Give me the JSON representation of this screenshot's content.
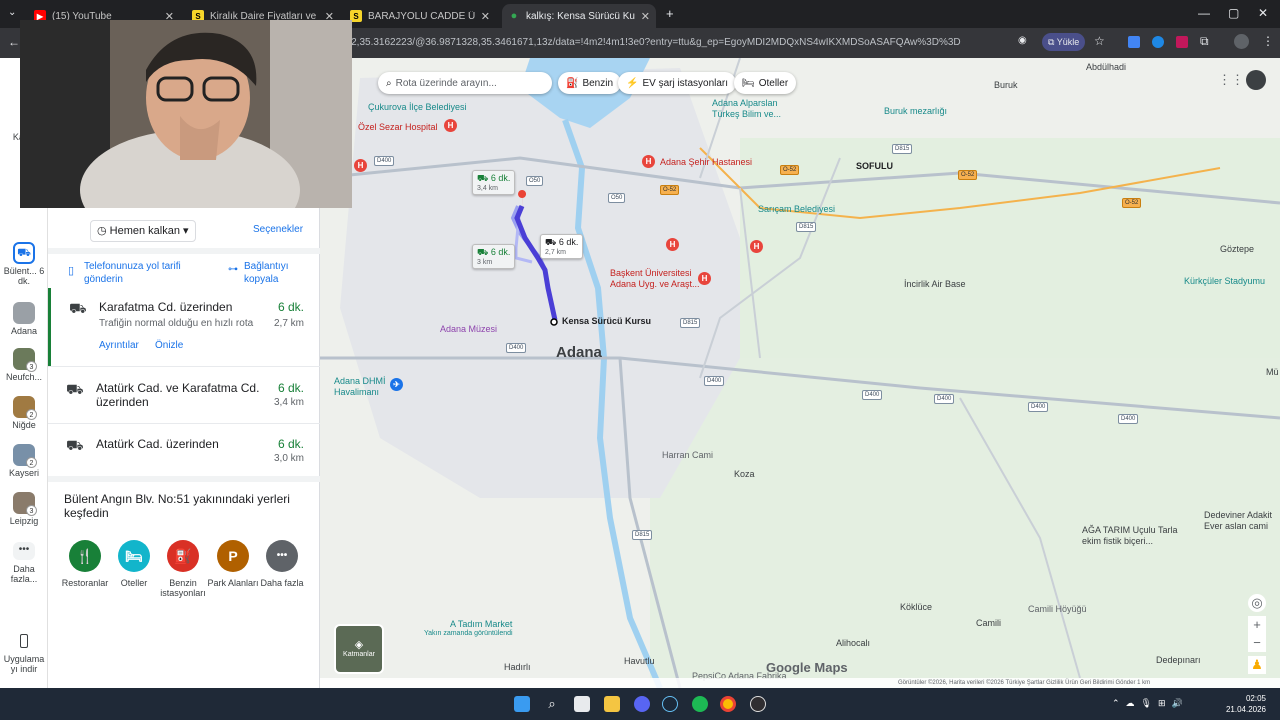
{
  "browser": {
    "tabs": [
      {
        "title": "(15) YouTube",
        "favicon_color": "#ff0000",
        "favicon_glyph": "▶"
      },
      {
        "title": "Kiralık Daire Fiyatları ve Kiralık",
        "favicon_color": "#f6d52a",
        "favicon_glyph": "S"
      },
      {
        "title": "BARAJYOLU CADDE ÜSTÜ BOŞ",
        "favicon_color": "#f6d52a",
        "favicon_glyph": "S"
      },
      {
        "title": "kalkış: Kensa Sürücü Kursu, Kur",
        "favicon_color": "#34a853",
        "favicon_glyph": "●",
        "active": true
      }
    ],
    "new_tab": "+",
    "window_controls": [
      "—",
      "▢",
      "✕"
    ],
    "url": "062,35.3162223/@36.9871328,35.3461671,13z/data=!4m2!4m1!3e0?entry=ttu&g_ep=EgoyMDI2MDQxNS4wIKXMDSoASAFQAw%3D%3D",
    "install_label": "Yükle"
  },
  "rail": {
    "items": [
      {
        "label": "Kay...",
        "badge": ""
      },
      {
        "label": "Bülent... 6 dk.",
        "badge": ""
      },
      {
        "label": "Adana",
        "badge": ""
      },
      {
        "label": "Neufch...",
        "badge": "3"
      },
      {
        "label": "Niğde",
        "badge": "2"
      },
      {
        "label": "Kayseri",
        "badge": "2"
      },
      {
        "label": "Leipzig",
        "badge": "3"
      },
      {
        "label": "Daha fazla...",
        "badge": ""
      },
      {
        "label": "Uygulama yı indir",
        "badge": ""
      }
    ]
  },
  "panel": {
    "depart_label": "Hemen kalkan",
    "options_label": "Seçenekler",
    "send_label": "Telefonunuza yol tarifi gönderin",
    "copy_label": "Bağlantıyı kopyala",
    "routes": [
      {
        "name": "Karafatma Cd. üzerinden",
        "time": "6 dk.",
        "dist": "2,7 km",
        "desc": "Trafiğin normal olduğu en hızlı rota",
        "details": "Ayrıntılar",
        "preview": "Önizle"
      },
      {
        "name": "Atatürk Cad. ve Karafatma Cd. üzerinden",
        "time": "6 dk.",
        "dist": "3,4 km"
      },
      {
        "name": "Atatürk Cad. üzerinden",
        "time": "6 dk.",
        "dist": "3,0 km"
      }
    ],
    "explore_title": "Bülent Angın Blv. No:51 yakınındaki yerleri keşfedin",
    "categories": [
      {
        "label": "Restoranlar",
        "color": "#188038",
        "glyph": "🍴"
      },
      {
        "label": "Oteller",
        "color": "#12b5cb",
        "glyph": "🛏"
      },
      {
        "label": "Benzin istasyonları",
        "color": "#d93025",
        "glyph": "⛽"
      },
      {
        "label": "Park Alanları",
        "color": "#b06000",
        "glyph": "P"
      },
      {
        "label": "Daha fazla",
        "color": "#5f6368",
        "glyph": "•••"
      }
    ]
  },
  "map": {
    "search_placeholder": "Rota üzerinde arayın...",
    "chips": [
      "Benzin",
      "EV şarj istasyonları",
      "Oteller"
    ],
    "labels": {
      "abdulhadi": "Abdülhadi",
      "cukurova": "Çukurova İlçe Belediyesi",
      "ozel_sezar": "Özel Sezar Hospital",
      "alparslan": "Adana Alparslan Türkeş Bilim ve...",
      "buruk_mezarligi": "Buruk mezarlığı",
      "buruk": "Buruk",
      "sehir_hastanesi": "Adana Şehir Hastanesi",
      "sofulu": "SOFULU",
      "saricam": "Sarıçam Belediyesi",
      "goztepe": "Göztepe",
      "baskent": "Başkent Üniversitesi Adana Uyg. ve Araşt...",
      "incirlik": "İncirlik Air Base",
      "kurkculer": "Kürkçüler Stadyumu",
      "destination": "Kensa Sürücü Kursu",
      "adana_muzesi": "Adana Müzesi",
      "adana": "Adana",
      "dhmi": "Adana DHMİ Havalimanı",
      "harran": "Harran Cami",
      "koza": "Koza",
      "agatarim": "AĞA TARIM Uçulu Tarla ekim fistik biçeri...",
      "devemir": "Dedeviner Adakit Ever aslan cami",
      "tadim": "A Tadım Market",
      "tadim_sub": "Yakın zamanda görüntülendi",
      "kokluce": "Köklüce",
      "camili_hoyugu": "Camili Höyüğü",
      "camili": "Camili",
      "alihocali": "Alihocalı",
      "hadirli": "Hadırlı",
      "havutlu": "Havutlu",
      "pepsico": "PepsiCo Adana Fabrika",
      "dedepinari": "Dedepınarı",
      "layers": "Katmanlar",
      "logo": "Google Maps",
      "mu": "Mü"
    },
    "callouts": {
      "primary_time": "6 dk.",
      "primary_dist": "2,7 km",
      "alt1_time": "6 dk.",
      "alt1_dist": "3,4 km",
      "alt2_time": "6 dk.",
      "alt2_dist": "3 km"
    },
    "footer": "Görüntüler ©2026, Harita verileri ©2026   Türkiye   Şartlar   Gizlilik   Ürün Geri Bildirimi Gönder   1 km"
  },
  "taskbar": {
    "time": "02:05",
    "date": "21.04.2026"
  }
}
